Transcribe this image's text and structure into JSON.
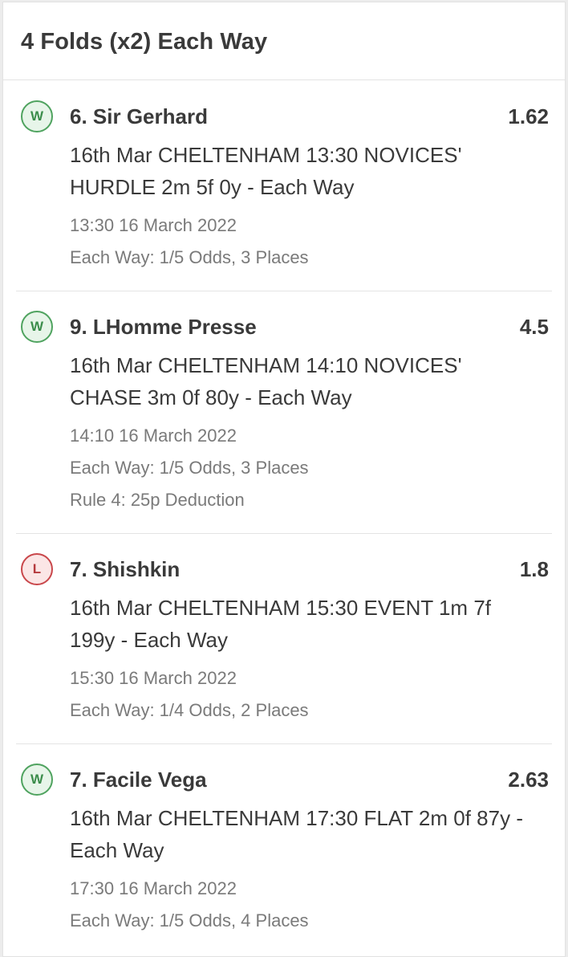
{
  "header": {
    "title": "4 Folds (x2) Each Way"
  },
  "selections": [
    {
      "result": "W",
      "name": "6. Sir Gerhard",
      "odds": "1.62",
      "description_lines": [
        "16th Mar CHELTENHAM 13:30 NOVICES'",
        "HURDLE 2m 5f 0y - Each Way"
      ],
      "time": "13:30 16 March 2022",
      "terms": "Each Way: 1/5 Odds, 3 Places"
    },
    {
      "result": "W",
      "name": "9. LHomme Presse",
      "odds": "4.5",
      "description_lines": [
        "16th Mar CHELTENHAM 14:10 NOVICES'",
        "CHASE 3m 0f 80y - Each Way"
      ],
      "time": "14:10 16 March 2022",
      "terms": "Each Way: 1/5 Odds, 3 Places",
      "rule4": "Rule 4: 25p Deduction"
    },
    {
      "result": "L",
      "name": "7. Shishkin",
      "odds": "1.8",
      "description_lines": [
        "16th Mar CHELTENHAM 15:30 EVENT 1m 7f",
        "199y - Each Way"
      ],
      "time": "15:30 16 March 2022",
      "terms": "Each Way: 1/4 Odds, 2 Places"
    },
    {
      "result": "W",
      "name": "7. Facile Vega",
      "odds": "2.63",
      "description_lines": [
        "16th Mar CHELTENHAM 17:30 FLAT 2m 0f 87y -",
        "Each Way"
      ],
      "time": "17:30 16 March 2022",
      "terms": "Each Way: 1/5 Odds, 4 Places"
    }
  ],
  "colors": {
    "win_border": "#4fa35f",
    "win_fill": "#e7f5e9",
    "loss_border": "#c9474b",
    "loss_fill": "#fbe6e6",
    "text": "#3a3a3a",
    "muted": "#7a7a7a"
  }
}
